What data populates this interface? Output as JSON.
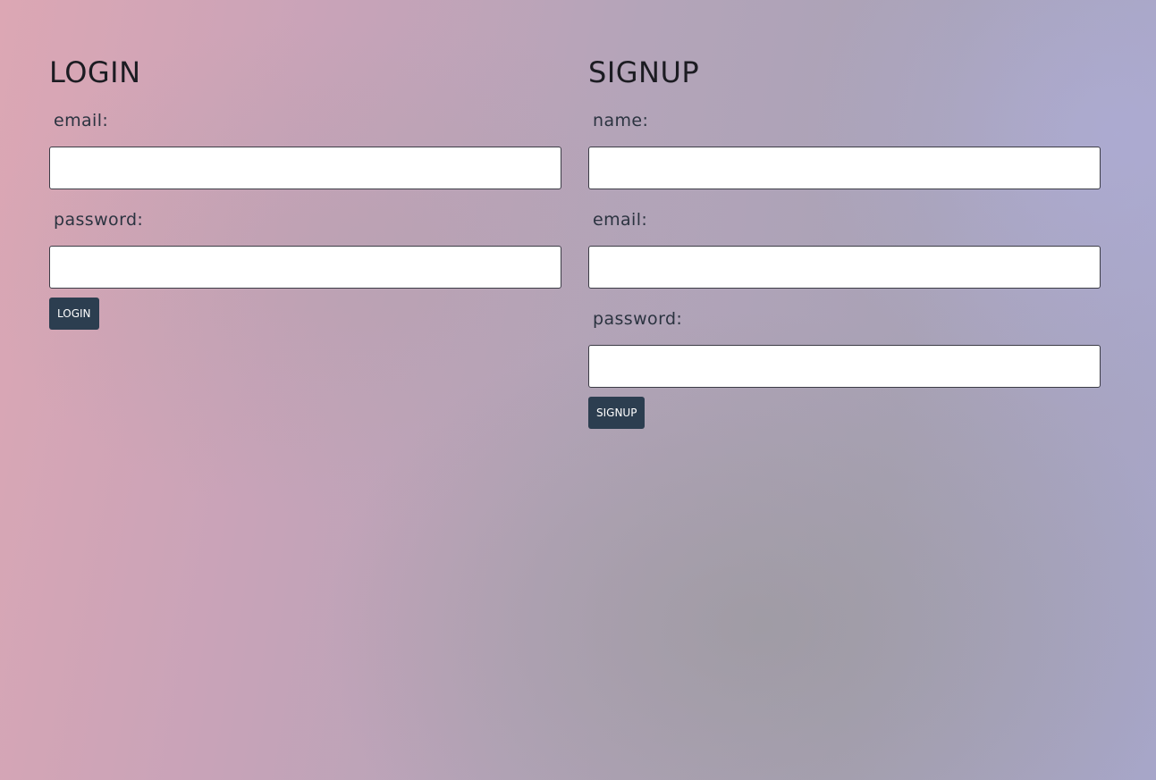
{
  "login": {
    "title": "LOGIN",
    "email_label": "email:",
    "email_value": "",
    "password_label": "password:",
    "password_value": "",
    "button_label": "LOGIN"
  },
  "signup": {
    "title": "SIGNUP",
    "name_label": "name:",
    "name_value": "",
    "email_label": "email:",
    "email_value": "",
    "password_label": "password:",
    "password_value": "",
    "button_label": "SIGNUP"
  },
  "colors": {
    "button_background": "#2c3e50",
    "input_border": "#3c3c46",
    "label_text": "#2b3340"
  }
}
